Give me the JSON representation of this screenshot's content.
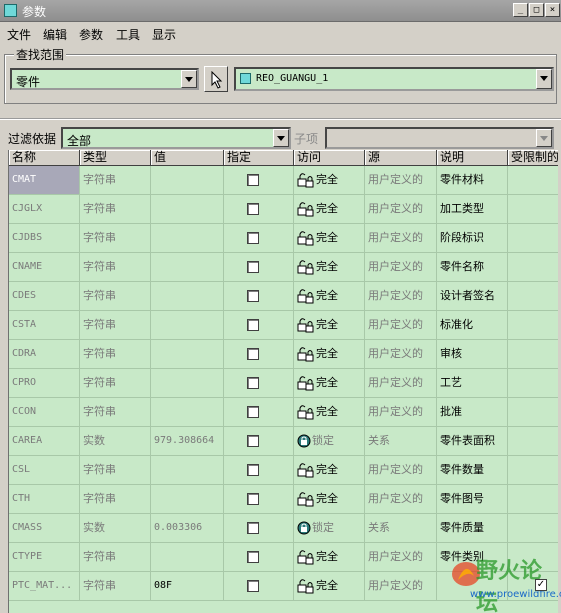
{
  "window": {
    "title": "参数"
  },
  "menu": [
    "文件",
    "编辑",
    "参数",
    "工具",
    "显示"
  ],
  "search_scope": {
    "label": "查找范围",
    "type_value": "零件",
    "model_value": "REO_GUANGU_1"
  },
  "filter": {
    "label": "过滤依据",
    "value": "全部",
    "subitem_label": "子项"
  },
  "table": {
    "headers": [
      "名称",
      "类型",
      "值",
      "指定",
      "访问",
      "源",
      "说明",
      "受限制的"
    ],
    "rows": [
      {
        "name": "CMAT",
        "type": "字符串",
        "value": "",
        "access": "完全",
        "source": "用户定义的",
        "desc": "零件材料"
      },
      {
        "name": "CJGLX",
        "type": "字符串",
        "value": "",
        "access": "完全",
        "source": "用户定义的",
        "desc": "加工类型"
      },
      {
        "name": "CJDBS",
        "type": "字符串",
        "value": "",
        "access": "完全",
        "source": "用户定义的",
        "desc": "阶段标识"
      },
      {
        "name": "CNAME",
        "type": "字符串",
        "value": "",
        "access": "完全",
        "source": "用户定义的",
        "desc": "零件名称"
      },
      {
        "name": "CDES",
        "type": "字符串",
        "value": "",
        "access": "完全",
        "source": "用户定义的",
        "desc": "设计者签名"
      },
      {
        "name": "CSTA",
        "type": "字符串",
        "value": "",
        "access": "完全",
        "source": "用户定义的",
        "desc": "标准化"
      },
      {
        "name": "CDRA",
        "type": "字符串",
        "value": "",
        "access": "完全",
        "source": "用户定义的",
        "desc": "审核"
      },
      {
        "name": "CPRO",
        "type": "字符串",
        "value": "",
        "access": "完全",
        "source": "用户定义的",
        "desc": "工艺"
      },
      {
        "name": "CCON",
        "type": "字符串",
        "value": "",
        "access": "完全",
        "source": "用户定义的",
        "desc": "批准"
      },
      {
        "name": "CAREA",
        "type": "实数",
        "value": "979.308664",
        "access": "锁定",
        "source": "关系",
        "desc": "零件表面积"
      },
      {
        "name": "CSL",
        "type": "字符串",
        "value": "",
        "access": "完全",
        "source": "用户定义的",
        "desc": "零件数量"
      },
      {
        "name": "CTH",
        "type": "字符串",
        "value": "",
        "access": "完全",
        "source": "用户定义的",
        "desc": "零件图号"
      },
      {
        "name": "CMASS",
        "type": "实数",
        "value": "0.003306",
        "access": "锁定",
        "source": "关系",
        "desc": "零件质量"
      },
      {
        "name": "CTYPE",
        "type": "字符串",
        "value": "",
        "access": "完全",
        "source": "用户定义的",
        "desc": "零件类别"
      },
      {
        "name": "PTC_MAT...",
        "type": "字符串",
        "value": "08F",
        "access": "完全",
        "source": "用户定义的",
        "desc": ""
      }
    ]
  },
  "watermark": {
    "text": "野火论坛",
    "url": "www.proewildfire.cn"
  }
}
